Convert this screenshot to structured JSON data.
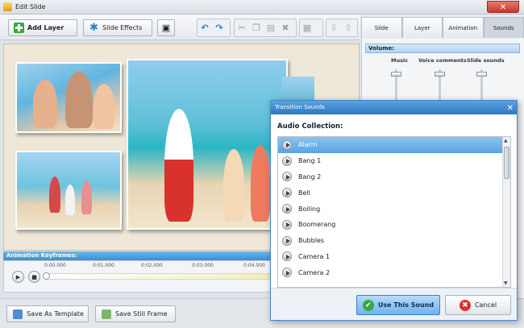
{
  "window": {
    "title": "Edit Slide",
    "close": "✕"
  },
  "toolbar": {
    "add_layer": "Add Layer",
    "slide_effects": "Slide Effects"
  },
  "tabs": [
    "Slide",
    "Layer",
    "Animation",
    "Sounds"
  ],
  "volume": {
    "header": "Volume:",
    "labels": [
      "Music",
      "Voice comments",
      "Slide sounds"
    ]
  },
  "keyframes": {
    "header": "Animation Keyframes:",
    "ticks": [
      "0:00.000",
      "0:01.000",
      "0:02.000",
      "0:03.000",
      "0:04.000"
    ]
  },
  "bottom": {
    "save_template": "Save As Template",
    "save_frame": "Save Still Frame"
  },
  "dialog": {
    "title": "Transition Sounds",
    "close": "✕",
    "label": "Audio Collection:",
    "items": [
      "Alarm",
      "Bang 1",
      "Bang 2",
      "Bell",
      "Boiling",
      "Boomerang",
      "Bubbles",
      "Camera 1",
      "Camera 2"
    ],
    "selected": "Alarm",
    "use_button": "Use This Sound",
    "cancel_button": "Cancel"
  }
}
